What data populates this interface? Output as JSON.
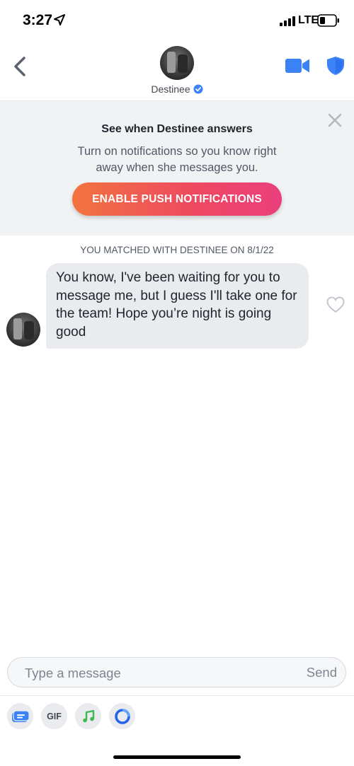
{
  "status_bar": {
    "time": "3:27",
    "network": "LTE",
    "icons": [
      "location-arrow-icon",
      "signal-icon",
      "battery-icon"
    ]
  },
  "header": {
    "name": "Destinee",
    "verified": true,
    "icons": [
      "back-chevron-icon",
      "video-camera-icon",
      "shield-icon",
      "verified-check-icon"
    ],
    "accent_color": "#3b82f6"
  },
  "notification": {
    "title": "See when Destinee answers",
    "body": "Turn on notifications so you know right away when she messages you.",
    "button_label": "ENABLE PUSH NOTIFICATIONS",
    "button_gradient": [
      "#f2733f",
      "#ea3f7d"
    ]
  },
  "conversation": {
    "matched_label": "YOU MATCHED WITH DESTINEE ON 8/1/22",
    "messages": [
      {
        "sender": "Destinee",
        "text": "You know, I've been waiting for you to message me, but I guess I'll take one for the team! Hope you’re night is going good"
      }
    ]
  },
  "composer": {
    "placeholder": "Type a message",
    "value": "",
    "send_label": "Send"
  },
  "toolbar": {
    "gif_label": "GIF",
    "items": [
      "sticker-icon",
      "gif-icon",
      "music-note-icon",
      "ring-icon"
    ]
  }
}
